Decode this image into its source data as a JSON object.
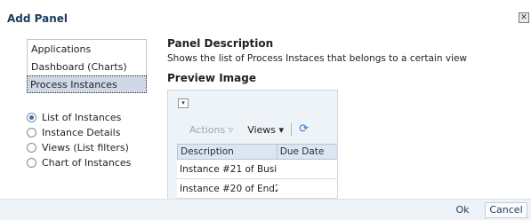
{
  "dialog": {
    "title": "Add Panel",
    "close_glyph": "✕"
  },
  "categories": [
    {
      "label": "Applications"
    },
    {
      "label": "Dashboard (Charts)"
    },
    {
      "label": "Process Instances"
    }
  ],
  "options": [
    {
      "label": "List of Instances",
      "selected": true
    },
    {
      "label": "Instance Details",
      "selected": false
    },
    {
      "label": "Views (List filters)",
      "selected": false
    },
    {
      "label": "Chart of Instances",
      "selected": false
    }
  ],
  "description": {
    "title": "Panel Description",
    "text": "Shows the list of Process Instaces that belongs to a certain view"
  },
  "preview": {
    "title": "Preview Image",
    "dropdown_glyph": "▾",
    "toolbar": {
      "actions": "Actions ▿",
      "views": "Views ▾",
      "refresh_icon": "refresh-icon"
    },
    "columns": [
      "Description",
      "Due Date"
    ],
    "rows": [
      "Instance #21 of Busi",
      "Instance #20 of End2"
    ]
  },
  "footer": {
    "ok_label": "Ok",
    "cancel_label": "Cancel"
  },
  "colors": {
    "accent": "#3b6db2",
    "title": "#1d3a5f",
    "selected_bg": "#cfd8e6",
    "footer_bg": "#eef3f8"
  }
}
